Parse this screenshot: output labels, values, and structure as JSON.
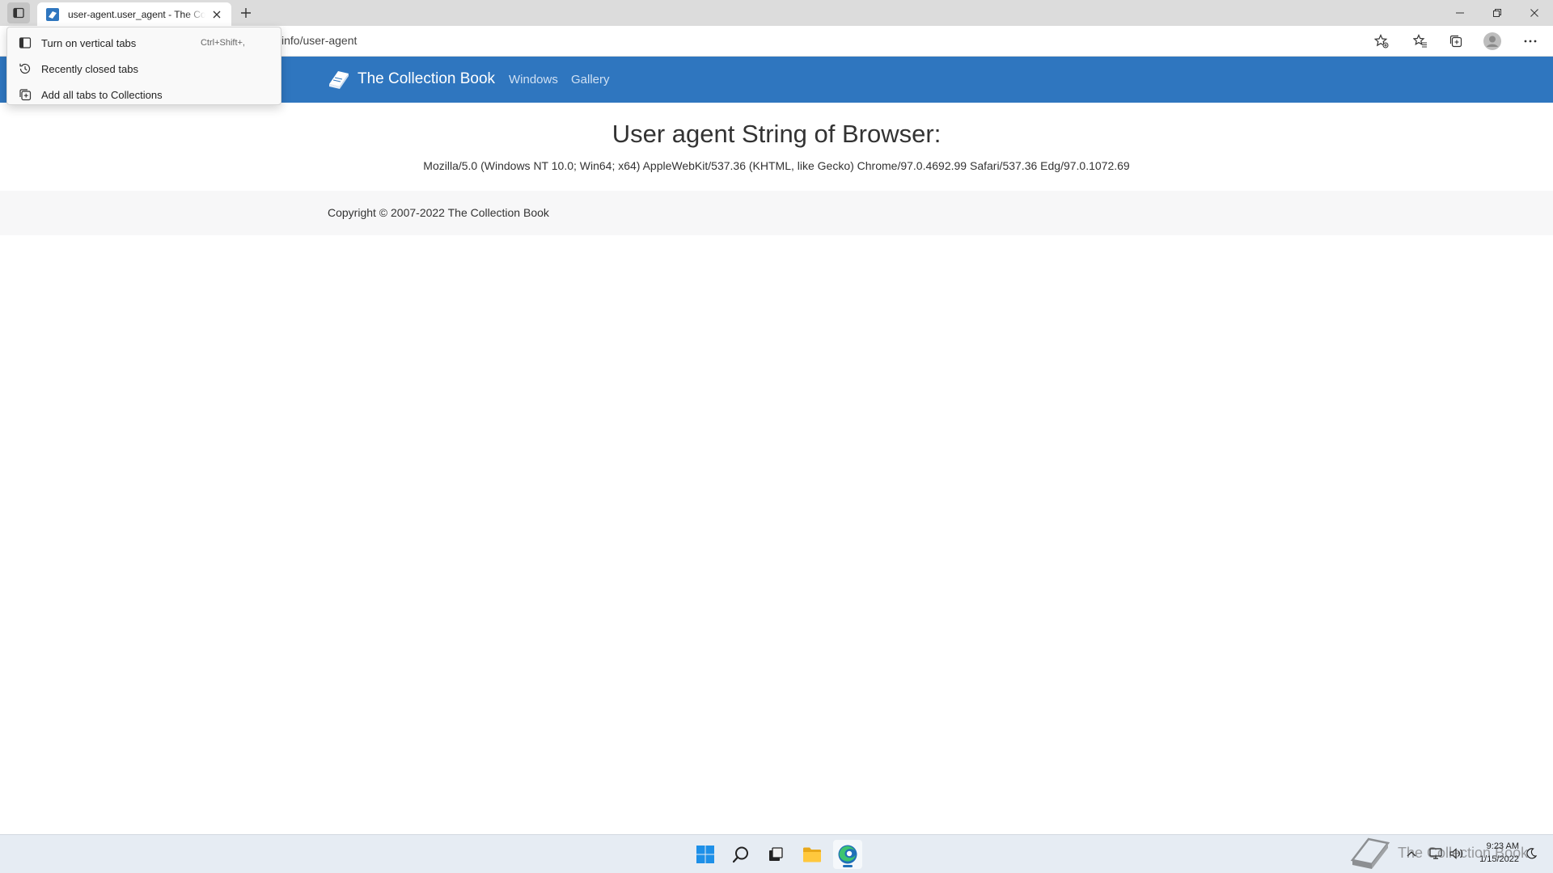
{
  "browser": {
    "tab": {
      "title": "user-agent.user_agent - The Collection Book"
    },
    "address_bar": {
      "url_visible": "info/user-agent"
    }
  },
  "tab_actions_menu": {
    "items": [
      {
        "label": "Turn on vertical tabs",
        "shortcut": "Ctrl+Shift+,",
        "icon": "vertical-tabs-icon"
      },
      {
        "label": "Recently closed tabs",
        "shortcut": "",
        "icon": "history-icon"
      },
      {
        "label": "Add all tabs to Collections",
        "shortcut": "",
        "icon": "collections-icon"
      }
    ]
  },
  "site": {
    "brand": "The Collection Book",
    "nav": [
      "Windows",
      "Gallery"
    ],
    "heading": "User agent String of Browser:",
    "user_agent": "Mozilla/5.0 (Windows NT 10.0; Win64; x64) AppleWebKit/537.36 (KHTML, like Gecko) Chrome/97.0.4692.99 Safari/537.36 Edg/97.0.1072.69",
    "copyright": "Copyright © 2007-2022 The Collection Book"
  },
  "taskbar": {
    "time": "9:23 AM",
    "date": "1/15/2022"
  },
  "watermark": {
    "text": "The Collection Book"
  },
  "colors": {
    "header_blue": "#2f76bf",
    "taskbar": "#e6ecf3",
    "edge_accent": "#1f6fb8"
  }
}
